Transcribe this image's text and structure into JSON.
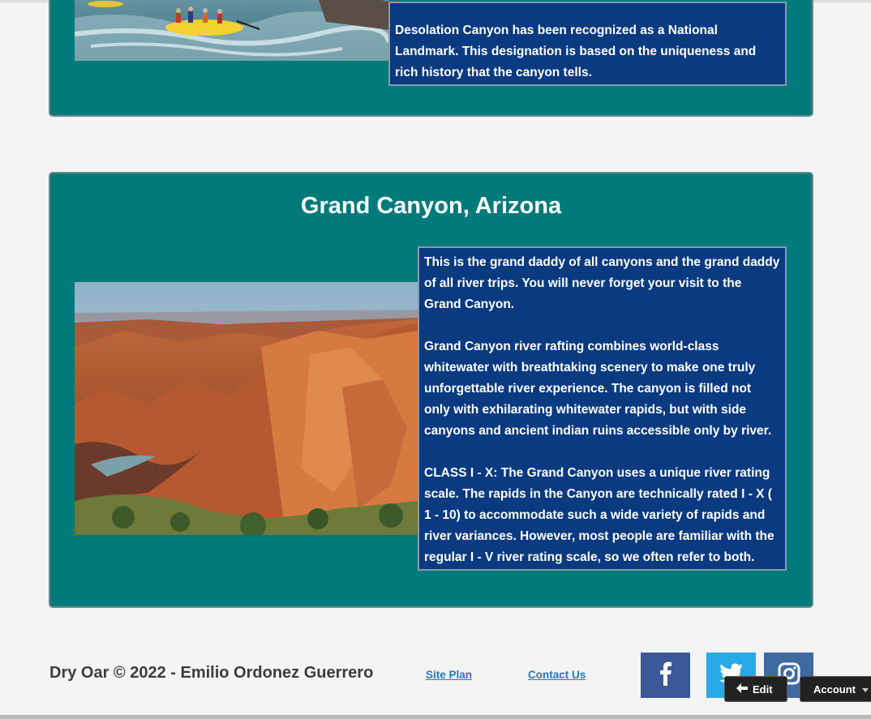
{
  "section_desolation": {
    "text": "Desolation Canyon has been recognized as a National Landmark. This designation is based on the uniqueness and rich history that the canyon tells."
  },
  "section_grand_canyon": {
    "title": "Grand Canyon, Arizona",
    "paragraphs": [
      "This is the grand daddy of all canyons and the grand daddy of all river trips. You will never forget your visit to the Grand Canyon.",
      "Grand Canyon river rafting combines world-class whitewater with breathtaking scenery to make one truly unforgettable river experience. The canyon is filled not only with exhilarating whitewater rapids, but with side canyons and ancient indian ruins accessible only by river.",
      "CLASS I - X: The Grand Canyon uses a unique river rating scale. The rapids in the Canyon are technically rated I - X ( 1 - 10) to accommodate such a wide variety of rapids and river variances. However, most people are familiar with the regular I - V river rating scale, so we often refer to both."
    ]
  },
  "footer": {
    "copyright": "Dry Oar © 2022 - Emilio Ordonez Guerrero",
    "links": [
      "Site Plan",
      "Contact Us"
    ],
    "social": [
      "facebook-icon",
      "twitter-icon",
      "instagram-icon"
    ]
  },
  "toolbar": {
    "edit_label": "Edit",
    "account_label": "Account"
  },
  "colors": {
    "card_bg": "#007a7a",
    "textbox_bg": "#0a3a80",
    "link": "#1f78c8",
    "facebook": "#3b5998",
    "twitter": "#29a9e8",
    "instagram": "#3f6aa0"
  }
}
